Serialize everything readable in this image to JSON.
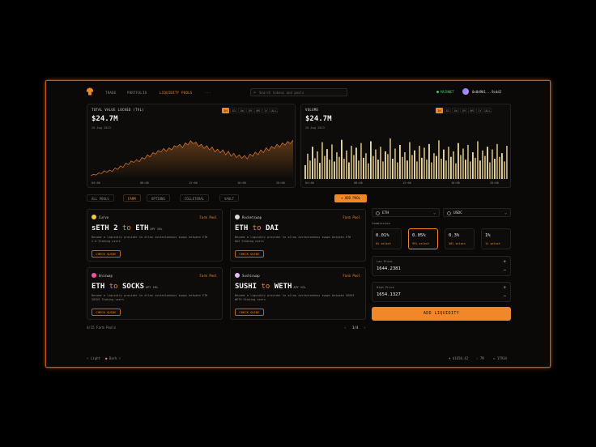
{
  "nav": {
    "links": [
      "TRADE",
      "PORTFOLIO",
      "LIQUIDITY POOLS",
      "···"
    ],
    "search_placeholder": "Search tokens and pools",
    "network": "MAINNET",
    "wallet": "0x8d901...9cdd2"
  },
  "tvl": {
    "title": "TOTAL VALUE LOCKED (TVL)",
    "value": "$24.7M",
    "date": "29 Aug 2023",
    "timeframes": [
      "1H",
      "1D",
      "1W",
      "1M",
      "6M",
      "1Y",
      "ALL"
    ],
    "active_tf": "1H",
    "x_ticks": [
      "04:00",
      "08:00",
      "12:00",
      "16:00",
      "20:00"
    ]
  },
  "volume": {
    "title": "VOLUME",
    "value": "$24.7M",
    "date": "29 Aug 2023",
    "timeframes": [
      "1H",
      "1D",
      "1W",
      "1M",
      "6M",
      "1Y",
      "ALL"
    ],
    "active_tf": "1H",
    "x_ticks": [
      "04:00",
      "08:00",
      "12:00",
      "16:00",
      "20:00"
    ]
  },
  "chart_data": [
    {
      "type": "area",
      "title": "TOTAL VALUE LOCKED (TVL)",
      "x": [
        "04:00",
        "08:00",
        "12:00",
        "16:00",
        "20:00"
      ],
      "values": [
        10,
        12,
        11,
        14,
        13,
        17,
        15,
        18,
        16,
        21,
        19,
        24,
        22,
        28,
        26,
        31,
        29,
        33,
        30,
        36,
        34,
        40,
        37,
        43,
        41,
        46,
        44,
        49,
        45,
        50,
        47,
        53,
        51,
        55,
        50,
        57,
        54,
        60,
        56,
        58,
        52,
        55,
        49,
        53,
        47,
        51,
        44,
        48,
        43,
        47,
        40,
        45,
        38,
        42,
        36,
        40,
        35,
        39,
        34,
        41,
        38,
        44,
        40,
        47,
        43,
        50,
        46,
        52,
        49,
        55,
        51,
        57,
        54,
        59,
        56,
        61
      ],
      "grid": false
    },
    {
      "type": "bar",
      "title": "VOLUME",
      "x": [
        "04:00",
        "08:00",
        "12:00",
        "16:00",
        "20:00"
      ],
      "values": [
        30,
        55,
        40,
        70,
        45,
        60,
        35,
        80,
        50,
        65,
        42,
        75,
        38,
        58,
        48,
        85,
        44,
        62,
        36,
        72,
        52,
        68,
        40,
        78,
        46,
        56,
        34,
        82,
        50,
        64,
        42,
        70,
        38,
        60,
        54,
        88,
        44,
        66,
        36,
        74,
        48,
        58,
        40,
        80,
        52,
        62,
        38,
        72,
        46,
        68,
        42,
        76,
        36,
        56,
        50,
        84,
        44,
        64,
        40,
        70,
        48,
        60,
        34,
        78,
        52,
        66,
        42,
        74,
        38,
        58,
        46,
        82,
        40,
        62,
        50,
        70,
        36,
        64,
        44,
        76,
        48,
        56,
        38,
        72
      ],
      "grid": false
    }
  ],
  "filters": {
    "tabs": [
      "ALL POOLS",
      "FARM",
      "OPTIONS",
      "COLLETERAL",
      "VAULT"
    ],
    "active": "FARM",
    "add_pool": "+ ADD POOL"
  },
  "pools": [
    {
      "protocol": "Curve",
      "type": "Farm Pool",
      "from": "sETH 2",
      "to_word": "to",
      "to": "ETH",
      "apy": "APY 15%",
      "desc": "Become a liquidity provider to allow instantaneous swaps between ETH 2.0 Staking users",
      "button": "CHECK GUIDE",
      "color": "#f5c842"
    },
    {
      "protocol": "Rocketswap",
      "type": "Farm Pool",
      "from": "ETH",
      "to_word": "to",
      "to": "DAI",
      "apy": "",
      "desc": "Become a liquidity provider to allow instantaneous swaps between ETH DAI Staking users",
      "button": "CHECK GUIDE",
      "color": "#dddddd"
    },
    {
      "protocol": "Uniswap",
      "type": "Farm Pool",
      "from": "ETH",
      "to_word": "to",
      "to": "SOCKS",
      "apy": "APY 18%",
      "desc": "Become a liquidity provider to allow instantaneous swaps between ETH SOCKS Staking users",
      "button": "CHECK GUIDE",
      "color": "#ff4fa3"
    },
    {
      "protocol": "Sushiswap",
      "type": "Farm Pool",
      "from": "SUSHI",
      "to_word": "to",
      "to": "WETH",
      "apy": "APY 12%",
      "desc": "Become a liquidity provider to allow instantaneous swaps between SUSHI WETH Staking users",
      "button": "CHECK GUIDE",
      "color": "#e6b8ff"
    }
  ],
  "pagination": {
    "count": "4/15 Farm Pools",
    "prev": "‹",
    "page": "1/4",
    "next": "›"
  },
  "swap": {
    "token_a": "ETH",
    "token_b": "USDC",
    "commission_label": "Commission",
    "fees": [
      {
        "value": "0.01%",
        "select": "0% select",
        "active": false
      },
      {
        "value": "0.05%",
        "select": "99% select",
        "active": true
      },
      {
        "value": "0.3%",
        "select": "40% select",
        "active": false
      },
      {
        "value": "1%",
        "select": "1% select",
        "active": false
      }
    ],
    "low_label": "Low Price",
    "low_value": "1644.2381",
    "high_label": "High Price",
    "high_value": "1654.1327",
    "add_liquidity": "ADD LIQUIDITY"
  },
  "footer": {
    "light": "Light",
    "dark": "Dark",
    "price": "$1650.42",
    "gas": "7M",
    "block": "17934"
  },
  "colors": {
    "accent": "#f0882a",
    "bg": "#0a0908",
    "success": "#43c46c"
  }
}
